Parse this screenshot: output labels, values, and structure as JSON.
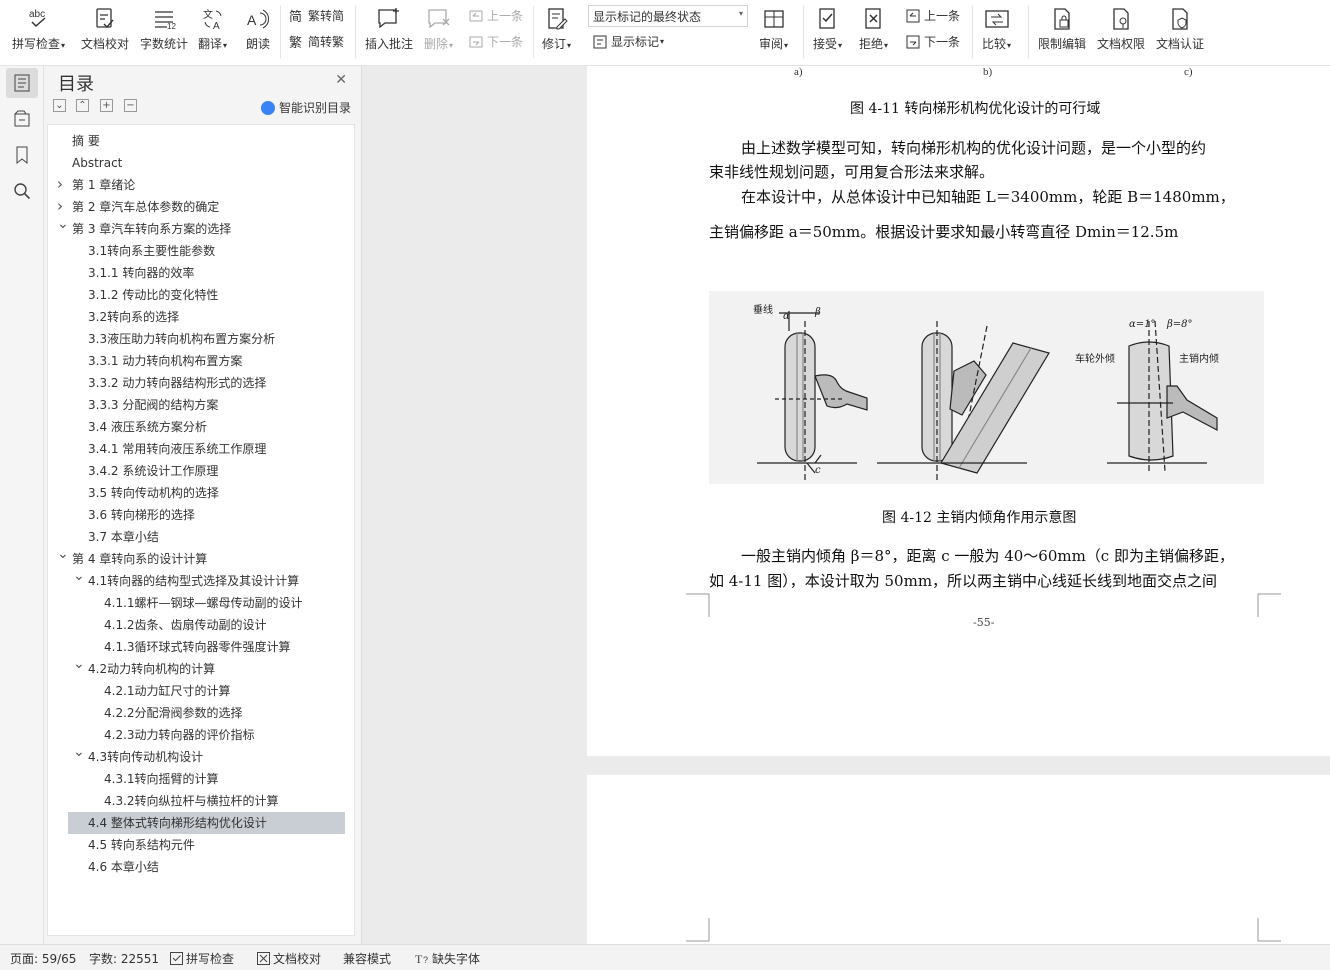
{
  "ribbon": {
    "spell_check": "拼写检查",
    "doc_proofread": "文档校对",
    "word_count": "字数统计",
    "translate": "翻译",
    "read_aloud": "朗读",
    "trad_to_simp": "繁转简",
    "simp_to_trad": "简转繁",
    "insert_comment": "插入批注",
    "delete": "删除",
    "prev_comment": "上一条",
    "next_comment": "下一条",
    "track_changes": "修订",
    "markup_state": "显示标记的最终状态",
    "show_markup": "显示标记",
    "review": "审阅",
    "accept": "接受",
    "reject": "拒绝",
    "prev_change": "上一条",
    "next_change": "下一条",
    "compare": "比较",
    "restrict_edit": "限制编辑",
    "doc_permission": "文档权限",
    "doc_certify": "文档认证"
  },
  "toc": {
    "title": "目录",
    "smart_label": "智能识别目录",
    "items": [
      {
        "label": "摘  要"
      },
      {
        "label": "Abstract"
      },
      {
        "label": "第 1 章绪论"
      },
      {
        "label": "第 2 章汽车总体参数的确定"
      },
      {
        "label": "第 3 章汽车转向系方案的选择"
      },
      {
        "label": "3.1转向系主要性能参数"
      },
      {
        "label": "3.1.1 转向器的效率"
      },
      {
        "label": "3.1.2 传动比的变化特性"
      },
      {
        "label": "3.2转向系的选择"
      },
      {
        "label": "3.3液压助力转向机构布置方案分析"
      },
      {
        "label": "3.3.1 动力转向机构布置方案"
      },
      {
        "label": "3.3.2 动力转向器结构形式的选择"
      },
      {
        "label": "3.3.3 分配阀的结构方案"
      },
      {
        "label": "3.4 液压系统方案分析"
      },
      {
        "label": "3.4.1 常用转向液压系统工作原理"
      },
      {
        "label": "3.4.2 系统设计工作原理"
      },
      {
        "label": "3.5 转向传动机构的选择"
      },
      {
        "label": "3.6 转向梯形的选择"
      },
      {
        "label": "3.7 本章小结"
      },
      {
        "label": "第 4 章转向系的设计计算"
      },
      {
        "label": "4.1转向器的结构型式选择及其设计计算"
      },
      {
        "label": "4.1.1螺杆—钢球—螺母传动副的设计"
      },
      {
        "label": "4.1.2齿条、齿扇传动副的设计"
      },
      {
        "label": "4.1.3循环球式转向器零件强度计算"
      },
      {
        "label": "4.2动力转向机构的计算"
      },
      {
        "label": "4.2.1动力缸尺寸的计算"
      },
      {
        "label": "4.2.2分配滑阀参数的选择"
      },
      {
        "label": "4.2.3动力转向器的评价指标"
      },
      {
        "label": "4.3转向传动机构设计"
      },
      {
        "label": "4.3.1转向摇臂的计算"
      },
      {
        "label": "4.3.2转向纵拉杆与横拉杆的计算"
      },
      {
        "label": "4.4 整体式转向梯形结构优化设计"
      },
      {
        "label": "4.5 转向系结构元件"
      },
      {
        "label": "4.6 本章小结"
      }
    ]
  },
  "document": {
    "sub_a": "a)",
    "sub_b": "b)",
    "sub_c": "c)",
    "fig411_caption": "图 4-11  转向梯形机构优化设计的可行域",
    "para1_line1": "由上述数学模型可知，转向梯形机构的优化设计问题，是一个小型的约",
    "para1_line2": "束非线性规划问题，可用复合形法来求解。",
    "para2_line1": "在本设计中，从总体设计中已知轴距 L＝3400mm，轮距 B＝1480mm，",
    "para2_line2": "主销偏移距 a＝50mm。根据设计要求知最小转弯直径 Dmin＝12.5m",
    "fig412_caption": "图 4-12 主销内倾角作用示意图",
    "para3_line1": "一般主销内倾角 β＝8°，距离 c 一般为 40～60mm（c 即为主销偏移距，",
    "para3_line2": "如 4-11 图），本设计取为 50mm，所以两主销中心线延长线到地面交点之间",
    "page_number": "-55-",
    "fig_labels": {
      "vertical_line": "垂线",
      "alpha": "α",
      "beta": "β",
      "c": "c",
      "alpha_val": "α=1°",
      "beta_val": "β=8°",
      "camber": "车轮外倾",
      "kingpin": "主销内倾"
    }
  },
  "status": {
    "page": "页面: 59/65",
    "words": "字数: 22551",
    "spell": "拼写检查",
    "proof": "文档校对",
    "compat": "兼容模式",
    "missing_font": "缺失字体"
  }
}
